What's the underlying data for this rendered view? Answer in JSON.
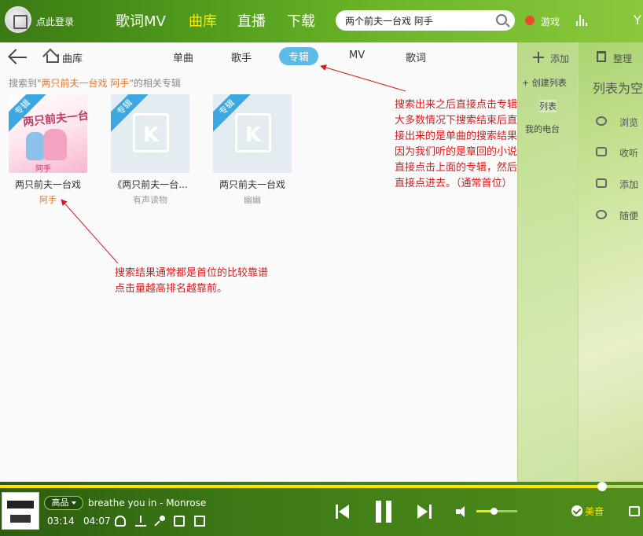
{
  "header": {
    "login": "点此登录",
    "nav": [
      "歌词MV",
      "曲库",
      "直播",
      "下载"
    ],
    "active_nav": 1,
    "search": {
      "value": "两个前夫一台戏 阿手"
    },
    "game": "游戏"
  },
  "main": {
    "home": "曲库",
    "tabs": [
      "单曲",
      "歌手",
      "专辑",
      "MV",
      "歌词"
    ],
    "active_tab": 2,
    "summary": {
      "prefix": "搜索到\"",
      "keyword": "两只前夫一台戏 阿手",
      "suffix": "\"的相关专辑"
    },
    "albums": [
      {
        "badge": "专辑",
        "title": "两只前夫一台戏",
        "artist": "阿手",
        "cover_title": "两只前夫一台戏",
        "cover_sub": "阿手"
      },
      {
        "badge": "专辑",
        "title": "《两只前夫一台...",
        "artist": "有声读物"
      },
      {
        "badge": "专辑",
        "title": "两只前夫一台戏",
        "artist": "幽幽"
      }
    ]
  },
  "annotations": {
    "a1": [
      "搜索出来之后直接点击专辑",
      "大多数情况下搜索结束后直",
      "接出来的是单曲的搜索结果，",
      "因为我们听的是章回的小说",
      "直接点击上面的专辑，然后",
      "直接点进去。（通常首位）"
    ],
    "a2": [
      "搜索结果通常都是首位的比较靠谱",
      "点击量越高排名越靠前。"
    ]
  },
  "right_panel": {
    "add": "添加",
    "organize": "整理",
    "sidebar": [
      "创建列表",
      "列表",
      "我的电台"
    ],
    "empty": "列表为空",
    "items": [
      "浏览",
      "收听",
      "添加",
      "随便"
    ]
  },
  "player": {
    "quality": "高品",
    "song": "breathe you in - Monrose",
    "elapsed": "03:14",
    "total": "04:07",
    "progress": 0.936,
    "volume": 0.42,
    "sound": "美音"
  },
  "colors": {
    "accent_blue": "#5cbbe6",
    "keyword_orange": "#e07828",
    "annotation_red": "#d21e1e",
    "nav_active": "#ffe700"
  }
}
